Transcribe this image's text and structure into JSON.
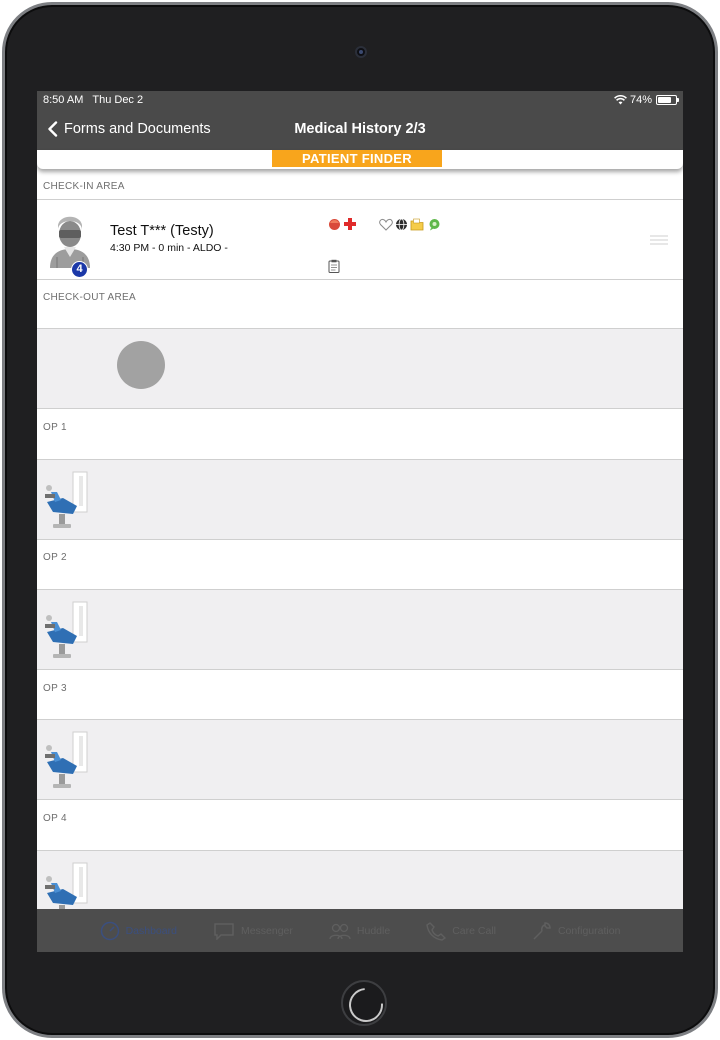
{
  "status_bar": {
    "time": "8:50 AM",
    "date": "Thu Dec 2",
    "battery": "74%",
    "battery_level": 0.74
  },
  "nav": {
    "back_label": "Forms and Documents",
    "title": "Medical History  2/3"
  },
  "finder": {
    "label": "PATIENT FINDER",
    "accent_color": "#f8a51c"
  },
  "sections": {
    "check_in": {
      "header": "CHECK-IN AREA",
      "patient": {
        "name": "Test T*** (Testy)",
        "detail": "4:30 PM - 0 min - ALDO -",
        "badge": "4",
        "icons": [
          "red-dot-icon",
          "red-cross-icon",
          "heart-outline-icon",
          "globe-icon",
          "folder-icon",
          "green-chat-icon",
          "clipboard-icon"
        ]
      }
    },
    "check_out": {
      "header": "CHECK-OUT AREA"
    },
    "op1": {
      "header": "OP 1"
    },
    "op2": {
      "header": "OP 2"
    },
    "op3": {
      "header": "OP 3"
    },
    "op4": {
      "header": "OP 4"
    }
  },
  "tabs": [
    {
      "label": "Dashboard",
      "icon": "dashboard-icon",
      "active": true
    },
    {
      "label": "Messenger",
      "icon": "messenger-icon",
      "active": false
    },
    {
      "label": "Huddle",
      "icon": "huddle-icon",
      "active": false
    },
    {
      "label": "Care Call",
      "icon": "phone-icon",
      "active": false
    },
    {
      "label": "Configuration",
      "icon": "wrench-icon",
      "active": false
    }
  ]
}
